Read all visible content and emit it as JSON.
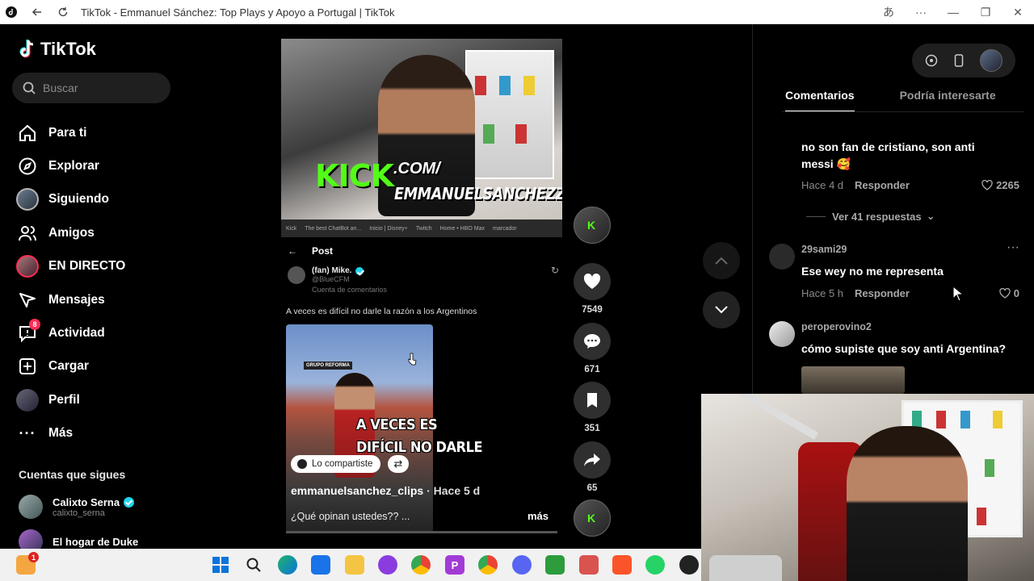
{
  "browser": {
    "title": "TikTok - Emmanuel Sánchez: Top Plays y Apoyo a Portugal | TikTok"
  },
  "sidebar": {
    "logo": "TikTok",
    "search_placeholder": "Buscar",
    "nav": [
      {
        "label": "Para ti",
        "icon": "home-icon"
      },
      {
        "label": "Explorar",
        "icon": "compass-icon"
      },
      {
        "label": "Siguiendo",
        "icon": "following-avatar"
      },
      {
        "label": "Amigos",
        "icon": "friends-icon"
      },
      {
        "label": "EN DIRECTO",
        "icon": "live-avatar"
      },
      {
        "label": "Mensajes",
        "icon": "messages-icon"
      },
      {
        "label": "Actividad",
        "icon": "activity-icon",
        "badge": "8"
      },
      {
        "label": "Cargar",
        "icon": "upload-icon"
      },
      {
        "label": "Perfil",
        "icon": "profile-avatar"
      },
      {
        "label": "Más",
        "icon": "more-icon"
      }
    ],
    "following_title": "Cuentas que sigues",
    "following": [
      {
        "name": "Calixto Serna",
        "handle": "calixto_serna",
        "verified": true
      },
      {
        "name": "El hogar de Duke",
        "handle": ""
      }
    ]
  },
  "video": {
    "stream": {
      "kick": "KICK",
      "kick_com": ".COM/",
      "kick_name": "EMMANUELSANCHEZZ",
      "bookmarks": [
        "Kick",
        "The best ChatBot an...",
        "Inicio | Disney+",
        "Twitch",
        "Home • HBO Max",
        "marcador"
      ]
    },
    "post": {
      "header": "Post",
      "author_name": "(fan) Mike.",
      "author_handle": "@BlueCFM",
      "community_note": "Cuenta de comentarios",
      "text": "A veces es difícil no darle la razón a los Argentinos",
      "img_tag": "GRUPO REFORMA"
    },
    "caption_line1": "A VECES ES",
    "caption_line2": "DIFÍCIL NO DARLE",
    "shared_chip": "Lo compartiste",
    "username": "emmanuelsanchez_clips",
    "time_ago": "· Hace 5 d",
    "description": "¿Qué opinan ustedes?? ...",
    "more": "más"
  },
  "actions": {
    "likes": "7549",
    "comments": "671",
    "saves": "351",
    "shares": "65"
  },
  "right_panel": {
    "tabs": [
      "Comentarios",
      "Podría interesarte"
    ],
    "comments": [
      {
        "user": "",
        "text": "no son fan de cristiano, son anti messi 🥰",
        "time": "Hace 4 d",
        "reply": "Responder",
        "likes": "2265"
      },
      {
        "user": "29sami29",
        "text": "Ese wey no me representa",
        "time": "Hace 5 h",
        "reply": "Responder",
        "likes": "0"
      },
      {
        "user": "peroperovino2",
        "text": "cómo supiste que soy anti Argentina?",
        "time": "",
        "reply": "",
        "likes": ""
      }
    ],
    "view_replies": "Ver 41 respuestas"
  },
  "taskbar": {
    "notification_badge": "1"
  }
}
